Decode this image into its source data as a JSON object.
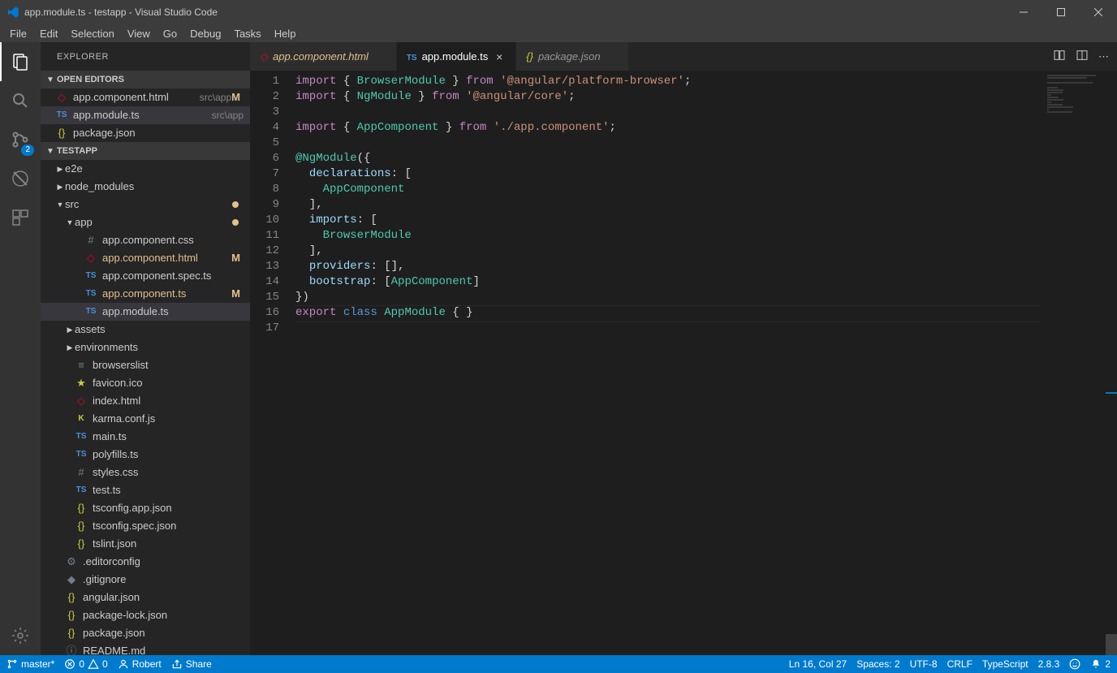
{
  "window": {
    "title": "app.module.ts - testapp - Visual Studio Code"
  },
  "menu": [
    "File",
    "Edit",
    "Selection",
    "View",
    "Go",
    "Debug",
    "Tasks",
    "Help"
  ],
  "activity": {
    "badge_scm": "2"
  },
  "sidebar": {
    "title": "EXPLORER",
    "sections": {
      "openEditors": "OPEN EDITORS",
      "project": "TESTAPP"
    }
  },
  "openEditors": [
    {
      "icon": "angular",
      "label": "app.component.html",
      "desc": "src\\app",
      "mod": "M"
    },
    {
      "icon": "ts",
      "label": "app.module.ts",
      "desc": "src\\app",
      "active": true
    },
    {
      "icon": "json",
      "label": "package.json",
      "desc": ""
    }
  ],
  "tree": [
    {
      "indent": 1,
      "chev": "▶",
      "icon": "",
      "label": "e2e"
    },
    {
      "indent": 1,
      "chev": "▶",
      "icon": "",
      "label": "node_modules"
    },
    {
      "indent": 1,
      "chev": "▼",
      "icon": "",
      "label": "src",
      "dot": true
    },
    {
      "indent": 2,
      "chev": "▼",
      "icon": "",
      "label": "app",
      "dot": true
    },
    {
      "indent": 3,
      "chev": "",
      "icon": "hash",
      "label": "app.component.css"
    },
    {
      "indent": 3,
      "chev": "",
      "icon": "angular",
      "label": "app.component.html",
      "mod": "M",
      "dim": true
    },
    {
      "indent": 3,
      "chev": "",
      "icon": "ts",
      "label": "app.component.spec.ts"
    },
    {
      "indent": 3,
      "chev": "",
      "icon": "ts",
      "label": "app.component.ts",
      "mod": "M",
      "dim": true
    },
    {
      "indent": 3,
      "chev": "",
      "icon": "ts",
      "label": "app.module.ts",
      "active": true
    },
    {
      "indent": 2,
      "chev": "▶",
      "icon": "",
      "label": "assets"
    },
    {
      "indent": 2,
      "chev": "▶",
      "icon": "",
      "label": "environments"
    },
    {
      "indent": 2,
      "chev": "",
      "icon": "eq",
      "label": "browserslist"
    },
    {
      "indent": 2,
      "chev": "",
      "icon": "star",
      "label": "favicon.ico"
    },
    {
      "indent": 2,
      "chev": "",
      "icon": "angular",
      "label": "index.html"
    },
    {
      "indent": 2,
      "chev": "",
      "icon": "js",
      "label": "karma.conf.js"
    },
    {
      "indent": 2,
      "chev": "",
      "icon": "ts",
      "label": "main.ts"
    },
    {
      "indent": 2,
      "chev": "",
      "icon": "ts",
      "label": "polyfills.ts"
    },
    {
      "indent": 2,
      "chev": "",
      "icon": "hash",
      "label": "styles.css"
    },
    {
      "indent": 2,
      "chev": "",
      "icon": "ts",
      "label": "test.ts"
    },
    {
      "indent": 2,
      "chev": "",
      "icon": "json",
      "label": "tsconfig.app.json"
    },
    {
      "indent": 2,
      "chev": "",
      "icon": "tsconfig.spec.json",
      "label": "tsconfig.spec.json",
      "fixicon": "json"
    },
    {
      "indent": 2,
      "chev": "",
      "icon": "json",
      "label": "tslint.json"
    },
    {
      "indent": 1,
      "chev": "",
      "icon": "gear",
      "label": ".editorconfig"
    },
    {
      "indent": 1,
      "chev": "",
      "icon": "git",
      "label": ".gitignore"
    },
    {
      "indent": 1,
      "chev": "",
      "icon": "json",
      "label": "angular.json"
    },
    {
      "indent": 1,
      "chev": "",
      "icon": "json",
      "label": "package-lock.json"
    },
    {
      "indent": 1,
      "chev": "",
      "icon": "json",
      "label": "package.json"
    },
    {
      "indent": 1,
      "chev": "",
      "icon": "info",
      "label": "README.md"
    }
  ],
  "tabs": [
    {
      "icon": "angular",
      "label": "app.component.html",
      "mod": true
    },
    {
      "icon": "ts",
      "label": "app.module.ts",
      "active": true,
      "close": true
    },
    {
      "icon": "json",
      "label": "package.json"
    }
  ],
  "code": {
    "lines": 17,
    "tokens": [
      [
        [
          "kw",
          "import"
        ],
        [
          "punc",
          " { "
        ],
        [
          "type",
          "BrowserModule"
        ],
        [
          "punc",
          " } "
        ],
        [
          "kw",
          "from"
        ],
        [
          "punc",
          " "
        ],
        [
          "str",
          "'@angular/platform-browser'"
        ],
        [
          "punc",
          ";"
        ]
      ],
      [
        [
          "kw",
          "import"
        ],
        [
          "punc",
          " { "
        ],
        [
          "type",
          "NgModule"
        ],
        [
          "punc",
          " } "
        ],
        [
          "kw",
          "from"
        ],
        [
          "punc",
          " "
        ],
        [
          "str",
          "'@angular/core'"
        ],
        [
          "punc",
          ";"
        ]
      ],
      [],
      [
        [
          "kw",
          "import"
        ],
        [
          "punc",
          " { "
        ],
        [
          "type",
          "AppComponent"
        ],
        [
          "punc",
          " } "
        ],
        [
          "kw",
          "from"
        ],
        [
          "punc",
          " "
        ],
        [
          "str",
          "'./app.component'"
        ],
        [
          "punc",
          ";"
        ]
      ],
      [],
      [
        [
          "dec",
          "@NgModule"
        ],
        [
          "punc",
          "({"
        ]
      ],
      [
        [
          "punc",
          "  "
        ],
        [
          "prop",
          "declarations"
        ],
        [
          "punc",
          ": ["
        ]
      ],
      [
        [
          "punc",
          "    "
        ],
        [
          "type",
          "AppComponent"
        ]
      ],
      [
        [
          "punc",
          "  ],"
        ]
      ],
      [
        [
          "punc",
          "  "
        ],
        [
          "prop",
          "imports"
        ],
        [
          "punc",
          ": ["
        ]
      ],
      [
        [
          "punc",
          "    "
        ],
        [
          "type",
          "BrowserModule"
        ]
      ],
      [
        [
          "punc",
          "  ],"
        ]
      ],
      [
        [
          "punc",
          "  "
        ],
        [
          "prop",
          "providers"
        ],
        [
          "punc",
          ": [],"
        ]
      ],
      [
        [
          "punc",
          "  "
        ],
        [
          "prop",
          "bootstrap"
        ],
        [
          "punc",
          ": ["
        ],
        [
          "type",
          "AppComponent"
        ],
        [
          "punc",
          "]"
        ]
      ],
      [
        [
          "punc",
          "})"
        ]
      ],
      [
        [
          "kw",
          "export"
        ],
        [
          "punc",
          " "
        ],
        [
          "decl",
          "class"
        ],
        [
          "punc",
          " "
        ],
        [
          "type",
          "AppModule"
        ],
        [
          "punc",
          " { }"
        ]
      ],
      []
    ]
  },
  "status": {
    "branch": "master*",
    "errors": "0",
    "warnings": "0",
    "user": "Robert",
    "share": "Share",
    "position": "Ln 16, Col 27",
    "spaces": "Spaces: 2",
    "encoding": "UTF-8",
    "eol": "CRLF",
    "language": "TypeScript",
    "tsver": "2.8.3",
    "notifications": "2"
  }
}
